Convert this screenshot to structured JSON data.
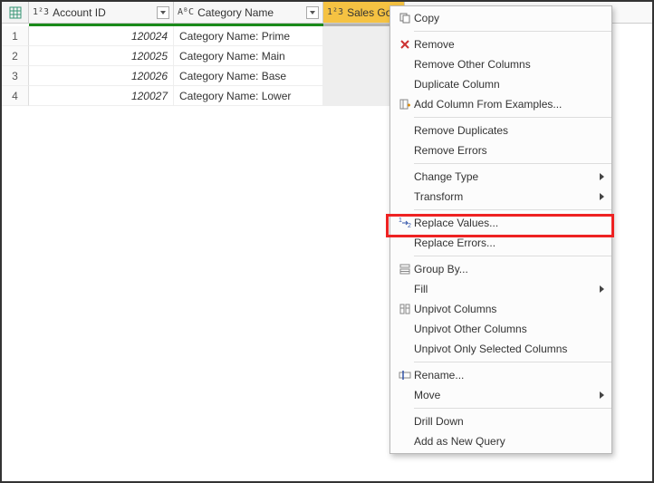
{
  "columns": [
    {
      "type_label": "1²3",
      "name": "Account ID"
    },
    {
      "type_label": "AᴮC",
      "name": "Category Name"
    },
    {
      "type_label": "1²3",
      "name": "Sales Goal"
    }
  ],
  "rows": [
    {
      "n": "1",
      "account_id": "120024",
      "category": "Category Name: Prime"
    },
    {
      "n": "2",
      "account_id": "120025",
      "category": "Category Name: Main"
    },
    {
      "n": "3",
      "account_id": "120026",
      "category": "Category Name: Base"
    },
    {
      "n": "4",
      "account_id": "120027",
      "category": "Category Name: Lower"
    }
  ],
  "menu": {
    "copy": "Copy",
    "remove": "Remove",
    "remove_other": "Remove Other Columns",
    "duplicate": "Duplicate Column",
    "add_examples": "Add Column From Examples...",
    "remove_dups": "Remove Duplicates",
    "remove_errors": "Remove Errors",
    "change_type": "Change Type",
    "transform": "Transform",
    "replace_values": "Replace Values...",
    "replace_errors": "Replace Errors...",
    "group_by": "Group By...",
    "fill": "Fill",
    "unpivot": "Unpivot Columns",
    "unpivot_other": "Unpivot Other Columns",
    "unpivot_sel": "Unpivot Only Selected Columns",
    "rename": "Rename...",
    "move": "Move",
    "drill_down": "Drill Down",
    "add_query": "Add as New Query"
  }
}
